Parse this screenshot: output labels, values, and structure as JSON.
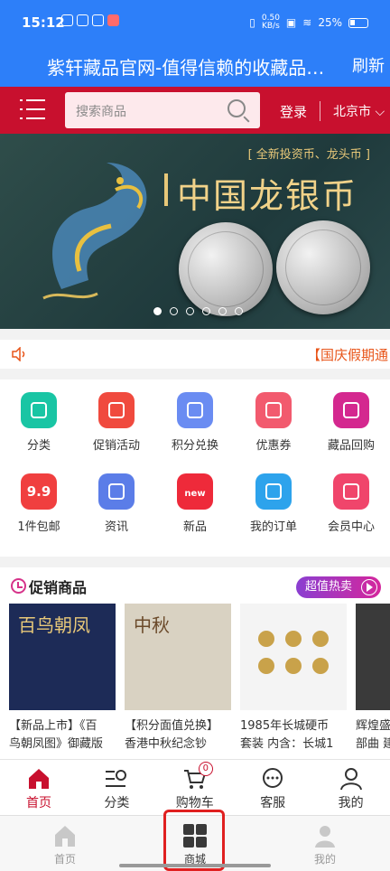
{
  "status_bar": {
    "time": "15:12",
    "net_speed_value": "0.50",
    "net_speed_unit": "KB/s",
    "battery": "25%"
  },
  "browser": {
    "title": "紫轩藏品官网-值得信赖的收藏品…",
    "refresh_label": "刷新"
  },
  "header": {
    "search_placeholder": "搜索商品",
    "login_label": "登录",
    "city": "北京市"
  },
  "banner": {
    "subtitle": "[ 全新投资币、龙头币 ]",
    "headline": "中国龙银币",
    "slide_count": 6,
    "active_slide": 1
  },
  "notice": {
    "text": "【国庆假期通"
  },
  "quick_links": [
    {
      "label": "分类",
      "icon": "grid-icon",
      "color": "#19c5a4"
    },
    {
      "label": "促销活动",
      "icon": "alarm-clock-icon",
      "color": "#f04a3e"
    },
    {
      "label": "积分兑换",
      "icon": "diamond-icon",
      "color": "#6a8cf2"
    },
    {
      "label": "优惠券",
      "icon": "coupon-icon",
      "color": "#f25a6e"
    },
    {
      "label": "藏品回购",
      "icon": "yen-icon",
      "color": "#d4288f"
    },
    {
      "label": "1件包邮",
      "icon": "nine-nine-icon",
      "glyph": "9.9",
      "color": "#f03f3f"
    },
    {
      "label": "资讯",
      "icon": "gift-icon",
      "color": "#5b7de8"
    },
    {
      "label": "新品",
      "icon": "new-icon",
      "glyph": "new",
      "color": "#ee2a3a"
    },
    {
      "label": "我的订单",
      "icon": "clipboard-icon",
      "color": "#2da3ec"
    },
    {
      "label": "会员中心",
      "icon": "user-icon",
      "color": "#f0456b"
    }
  ],
  "promo": {
    "heading": "促销商品",
    "hot_label": "超值热卖",
    "products": [
      {
        "line1": "【新品上市】《百",
        "line2": "鸟朝凤图》御藏版",
        "img_text": "百鸟朝凤"
      },
      {
        "line1": "【积分面值兑换】",
        "line2": "香港中秋纪念钞",
        "img_text": "中秋"
      },
      {
        "line1": "1985年长城硬币",
        "line2": "套装 内含：长城1",
        "img_text": ""
      },
      {
        "line1": "辉煌盛",
        "line2": "部曲 建",
        "img_text": ""
      }
    ]
  },
  "site_tabs": [
    {
      "label": "首页",
      "icon": "home-icon",
      "active": true
    },
    {
      "label": "分类",
      "icon": "category-search-icon",
      "active": false
    },
    {
      "label": "购物车",
      "icon": "cart-icon",
      "active": false,
      "badge": "0"
    },
    {
      "label": "客服",
      "icon": "chat-icon",
      "active": false
    },
    {
      "label": "我的",
      "icon": "person-icon",
      "active": false
    }
  ],
  "app_tabs": [
    {
      "label": "首页",
      "icon": "home-icon",
      "active": false
    },
    {
      "label": "商城",
      "icon": "mall-grid-icon",
      "active": true
    },
    {
      "label": "我的",
      "icon": "person-icon",
      "active": false
    }
  ]
}
